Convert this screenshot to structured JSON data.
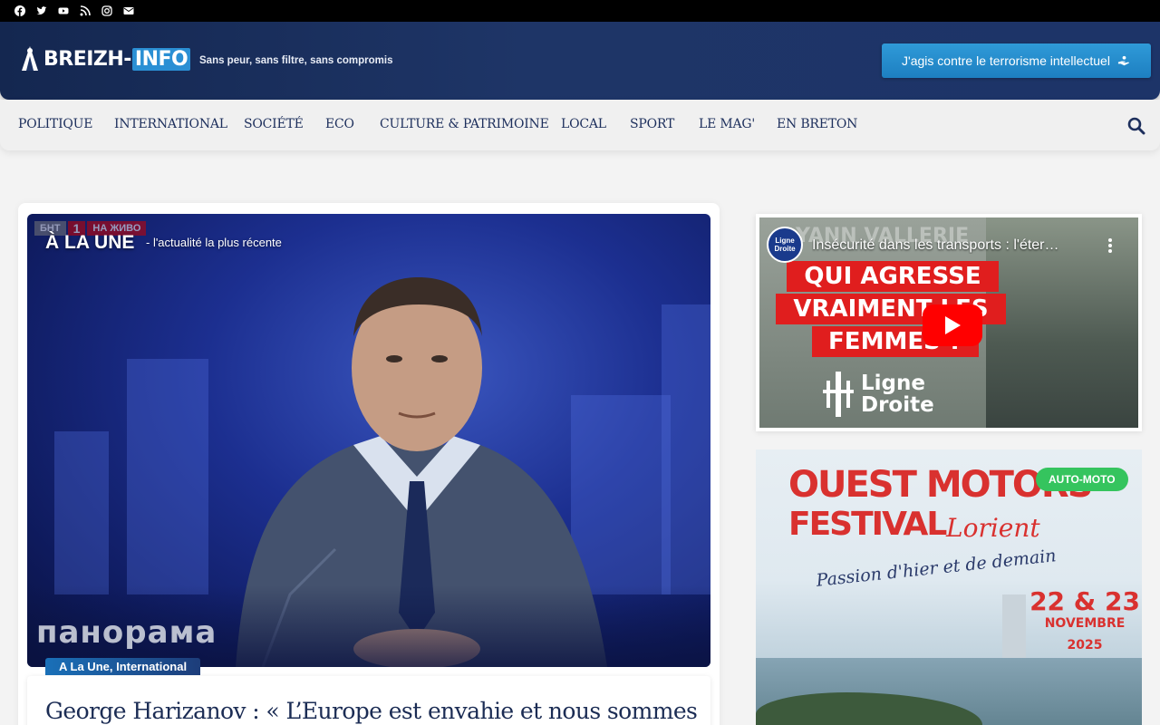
{
  "social": [
    "facebook-icon",
    "twitter-icon",
    "youtube-icon",
    "rss-icon",
    "instagram-icon",
    "envelope-icon"
  ],
  "brand": {
    "logo_word": "BREIZH-",
    "logo_info": "INFO",
    "tagline": "Sans peur, sans filtre, sans compromis",
    "cta_label": "J'agis contre le terrorisme intellectuel"
  },
  "nav": {
    "items": [
      "POLITIQUE",
      "INTERNATIONAL",
      "SOCIÉTÉ",
      "ECO",
      "CULTURE & PATRIMOINE",
      "LOCAL",
      "SPORT",
      "LE MAG'",
      "EN BRETON"
    ]
  },
  "hero": {
    "section_title": "À LA UNE",
    "section_sub": "- l'actualité la plus récente",
    "categories": "A La Une, International",
    "article_title": "George Harizanov : « L’Europe est envahie et nous sommes la",
    "image_caption": "панорама",
    "image_live": [
      "БНТ",
      "1",
      "НА ЖИВО"
    ]
  },
  "video": {
    "title": "Insécurité dans les transports : l'éter…",
    "channel": "Ligne Droite",
    "banner_top": "YANN VALLERIE",
    "banner_lines": [
      "QUI AGRESSE",
      "VRAIMENT LES",
      "FEMMES ?"
    ],
    "brand_line1": "Ligne",
    "brand_line2": "Droite"
  },
  "ad": {
    "badge": "AUTO-MOTO",
    "line1": "OUEST MOTORS",
    "line2": "FESTIVAL",
    "city": "Lorient",
    "slogan": "Passion d'hier et de demain",
    "date": "22 & 23",
    "month": "NOVEMBRE 2025"
  },
  "colors": {
    "header": "#1e3567",
    "accent": "#2a8fd4",
    "nav_text": "#1d2f5c",
    "badge_green": "#35c45e"
  }
}
